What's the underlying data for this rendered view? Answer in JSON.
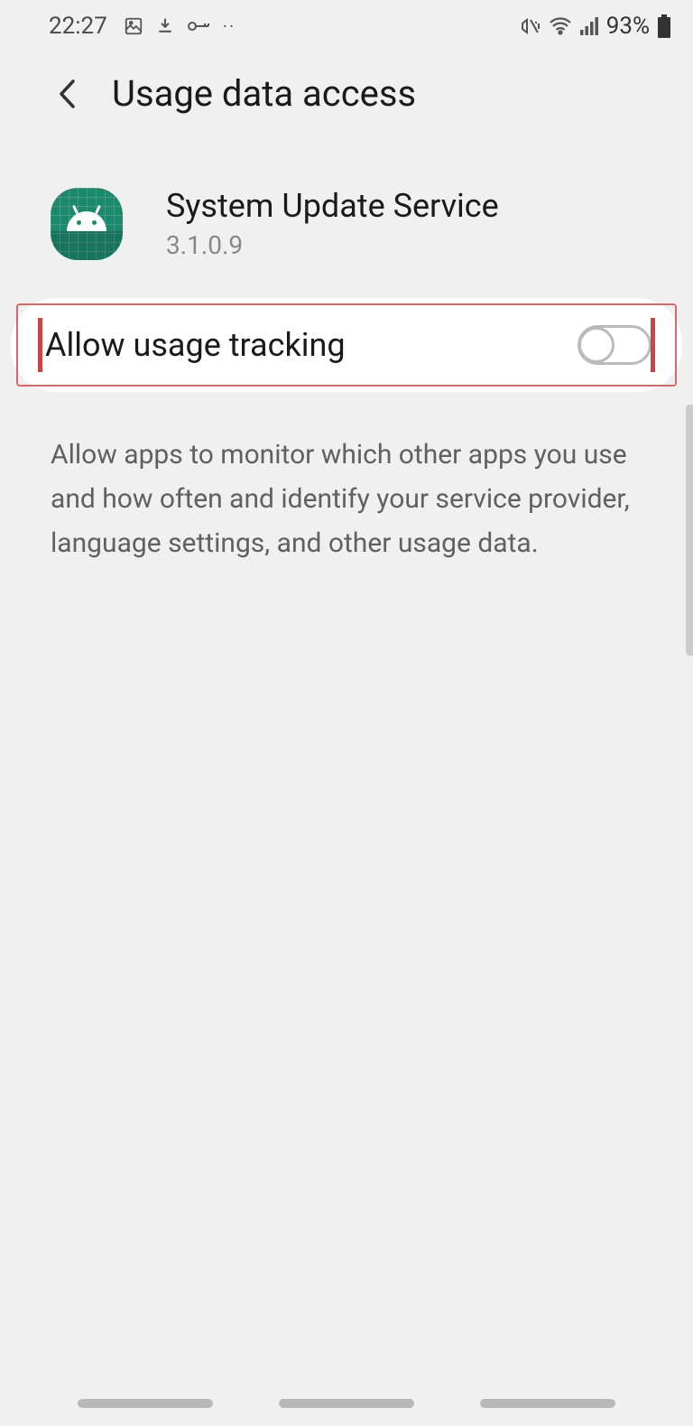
{
  "status": {
    "time": "22:27",
    "battery_pct": "93%"
  },
  "header": {
    "title": "Usage data access"
  },
  "app": {
    "name": "System Update Service",
    "version": "3.1.0.9"
  },
  "toggle": {
    "label": "Allow usage tracking",
    "state": "off"
  },
  "description": "Allow apps to monitor which other apps you use and how often and identify your service provider, language settings, and other usage data."
}
